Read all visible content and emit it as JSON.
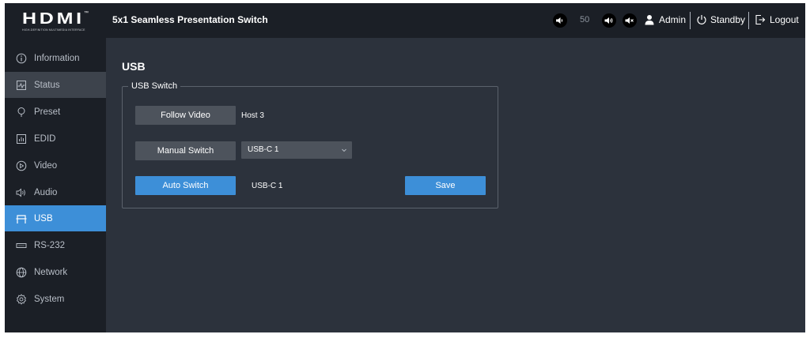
{
  "header": {
    "logo_text": "HDMI",
    "logo_tm": "™",
    "logo_subtitle": "HIGH-DEFINITION MULTIMEDIA INTERFACE",
    "app_title": "5x1 Seamless Presentation Switch",
    "volume_value": "50",
    "user_label": "Admin",
    "standby_label": "Standby",
    "logout_label": "Logout"
  },
  "sidebar": {
    "items": [
      {
        "label": "Information",
        "icon": "info-icon"
      },
      {
        "label": "Status",
        "icon": "status-icon"
      },
      {
        "label": "Preset",
        "icon": "preset-icon"
      },
      {
        "label": "EDID",
        "icon": "edid-icon"
      },
      {
        "label": "Video",
        "icon": "video-icon"
      },
      {
        "label": "Audio",
        "icon": "audio-icon"
      },
      {
        "label": "USB",
        "icon": "usb-icon"
      },
      {
        "label": "RS-232",
        "icon": "rs232-icon"
      },
      {
        "label": "Network",
        "icon": "network-icon"
      },
      {
        "label": "System",
        "icon": "system-icon"
      }
    ],
    "active": "USB"
  },
  "main": {
    "page_title": "USB",
    "section_title": "USB Switch",
    "follow_video_label": "Follow Video",
    "follow_video_value": "Host 3",
    "manual_switch_label": "Manual Switch",
    "manual_switch_selected": "USB-C 1",
    "auto_switch_label": "Auto Switch",
    "auto_switch_value": "USB-C 1",
    "save_label": "Save"
  },
  "colors": {
    "accent": "#3d8fd8",
    "header_bg": "#1b1f26",
    "content_bg": "#2c323c",
    "button_gray": "#4d535c"
  }
}
